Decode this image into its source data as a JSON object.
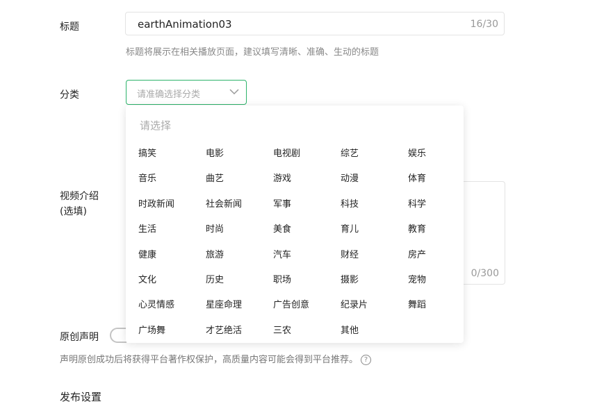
{
  "title_field": {
    "label": "标题",
    "value": "earthAnimation03",
    "count": "16/30",
    "hint": "标题将展示在相关播放页面，建议填写清晰、准确、生动的标题"
  },
  "category_field": {
    "label": "分类",
    "placeholder": "请准确选择分类",
    "icon": "chevron-down-icon",
    "accent_color": "#2cb36a"
  },
  "dropdown": {
    "title": "请选择",
    "options": [
      "搞笑",
      "电影",
      "电视剧",
      "综艺",
      "娱乐",
      "音乐",
      "曲艺",
      "游戏",
      "动漫",
      "体育",
      "时政新闻",
      "社会新闻",
      "军事",
      "科技",
      "科学",
      "生活",
      "时尚",
      "美食",
      "育儿",
      "教育",
      "健康",
      "旅游",
      "汽车",
      "财经",
      "房产",
      "文化",
      "历史",
      "职场",
      "摄影",
      "宠物",
      "心灵情感",
      "星座命理",
      "广告创意",
      "纪录片",
      "舞蹈",
      "广场舞",
      "才艺绝活",
      "三农",
      "其他"
    ]
  },
  "description_field": {
    "label_line1": "视频介绍",
    "label_line2": "(选填)",
    "count": "0/300"
  },
  "original_field": {
    "label": "原创声明",
    "hint": "声明原创成功后将获得平台著作权保护，高质量内容可能会得到平台推荐。",
    "help_icon": "question-circle-icon",
    "help_glyph": "?"
  },
  "publish_settings": {
    "label": "发布设置"
  }
}
